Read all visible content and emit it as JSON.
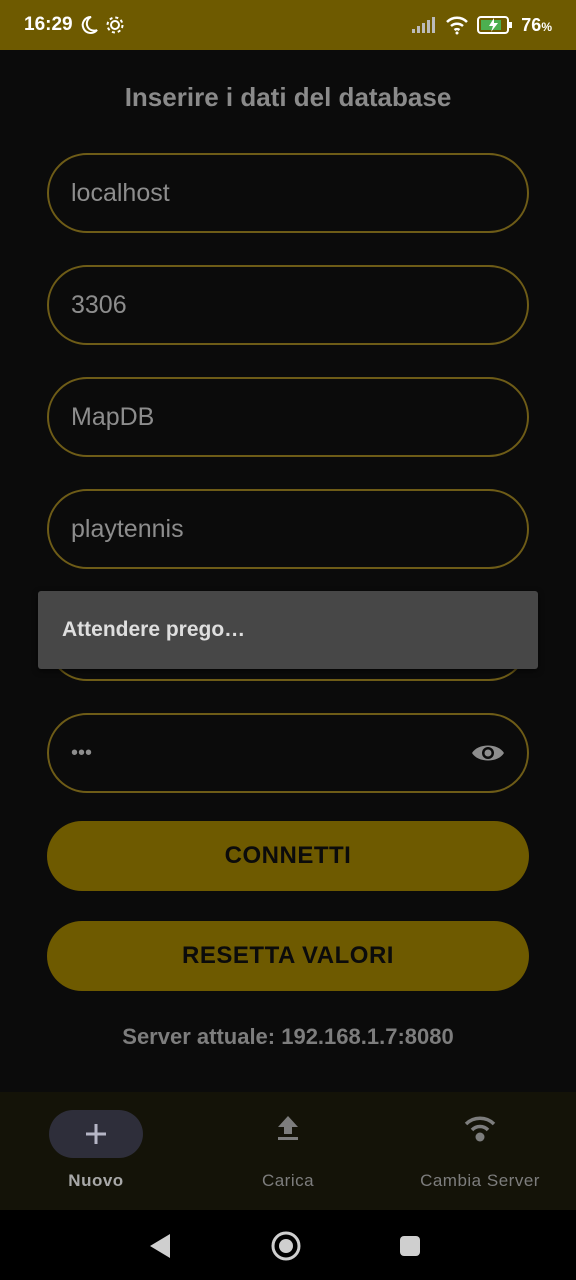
{
  "status": {
    "time": "16:29",
    "battery": "76",
    "battery_unit": "%"
  },
  "form": {
    "title": "Inserire i dati del database",
    "host": "localhost",
    "port": "3306",
    "database": "MapDB",
    "table": "playtennis",
    "password_mask": "•••"
  },
  "buttons": {
    "connect": "CONNETTI",
    "reset": "RESETTA VALORI"
  },
  "server_info": "Server attuale: 192.168.1.7:8080",
  "dialog": {
    "message": "Attendere prego…"
  },
  "nav": [
    {
      "label": "Nuovo",
      "icon": "plus-icon",
      "active": true
    },
    {
      "label": "Carica",
      "icon": "upload-icon",
      "active": false
    },
    {
      "label": "Cambia Server",
      "icon": "wifi-icon",
      "active": false
    }
  ],
  "colors": {
    "accent": "#6e5a00",
    "field_border": "#6e5c17",
    "background": "#0b0b0b",
    "dialog": "#474747"
  }
}
